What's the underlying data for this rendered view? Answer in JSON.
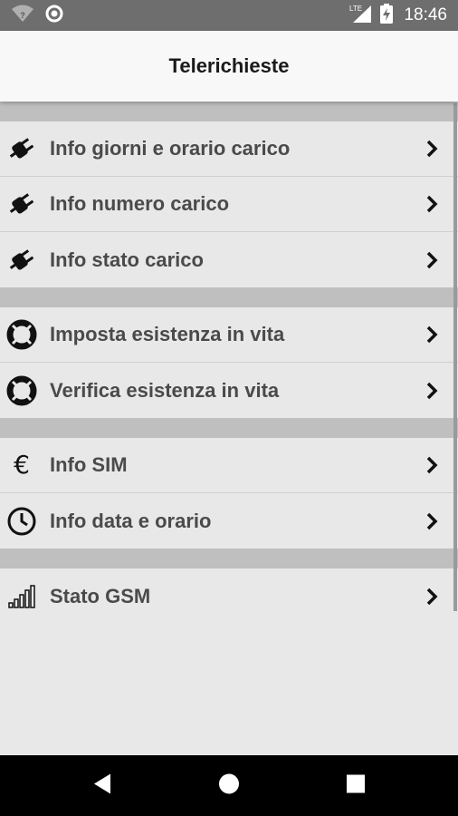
{
  "status_bar": {
    "time": "18:46",
    "network_type": "LTE",
    "icons": [
      "wifi-unknown-icon",
      "sync-circle-icon",
      "signal-icon",
      "battery-charging-icon"
    ]
  },
  "app_bar": {
    "title": "Telerichieste"
  },
  "groups": [
    {
      "items": [
        {
          "label": "Info giorni e orario carico",
          "icon": "plug-icon"
        },
        {
          "label": "Info numero carico",
          "icon": "plug-icon"
        },
        {
          "label": "Info stato carico",
          "icon": "plug-icon"
        }
      ]
    },
    {
      "items": [
        {
          "label": "Imposta esistenza in vita",
          "icon": "lifebuoy-icon"
        },
        {
          "label": "Verifica esistenza in vita",
          "icon": "lifebuoy-icon"
        }
      ]
    },
    {
      "items": [
        {
          "label": "Info SIM",
          "icon": "euro-icon",
          "glyph": "€"
        },
        {
          "label": "Info data e orario",
          "icon": "clock-icon"
        }
      ]
    },
    {
      "items": [
        {
          "label": "Stato GSM",
          "icon": "signal-bars-icon"
        }
      ]
    }
  ],
  "nav_bar": {
    "buttons": [
      "back-icon",
      "home-icon",
      "recents-icon"
    ]
  },
  "colors": {
    "status_bar": "#6e6e6e",
    "app_bar": "#f8f8f8",
    "list_bg": "#e8e8e8",
    "separator": "#bfbfbf",
    "label": "#4a4a4a",
    "nav_bar": "#000000"
  }
}
